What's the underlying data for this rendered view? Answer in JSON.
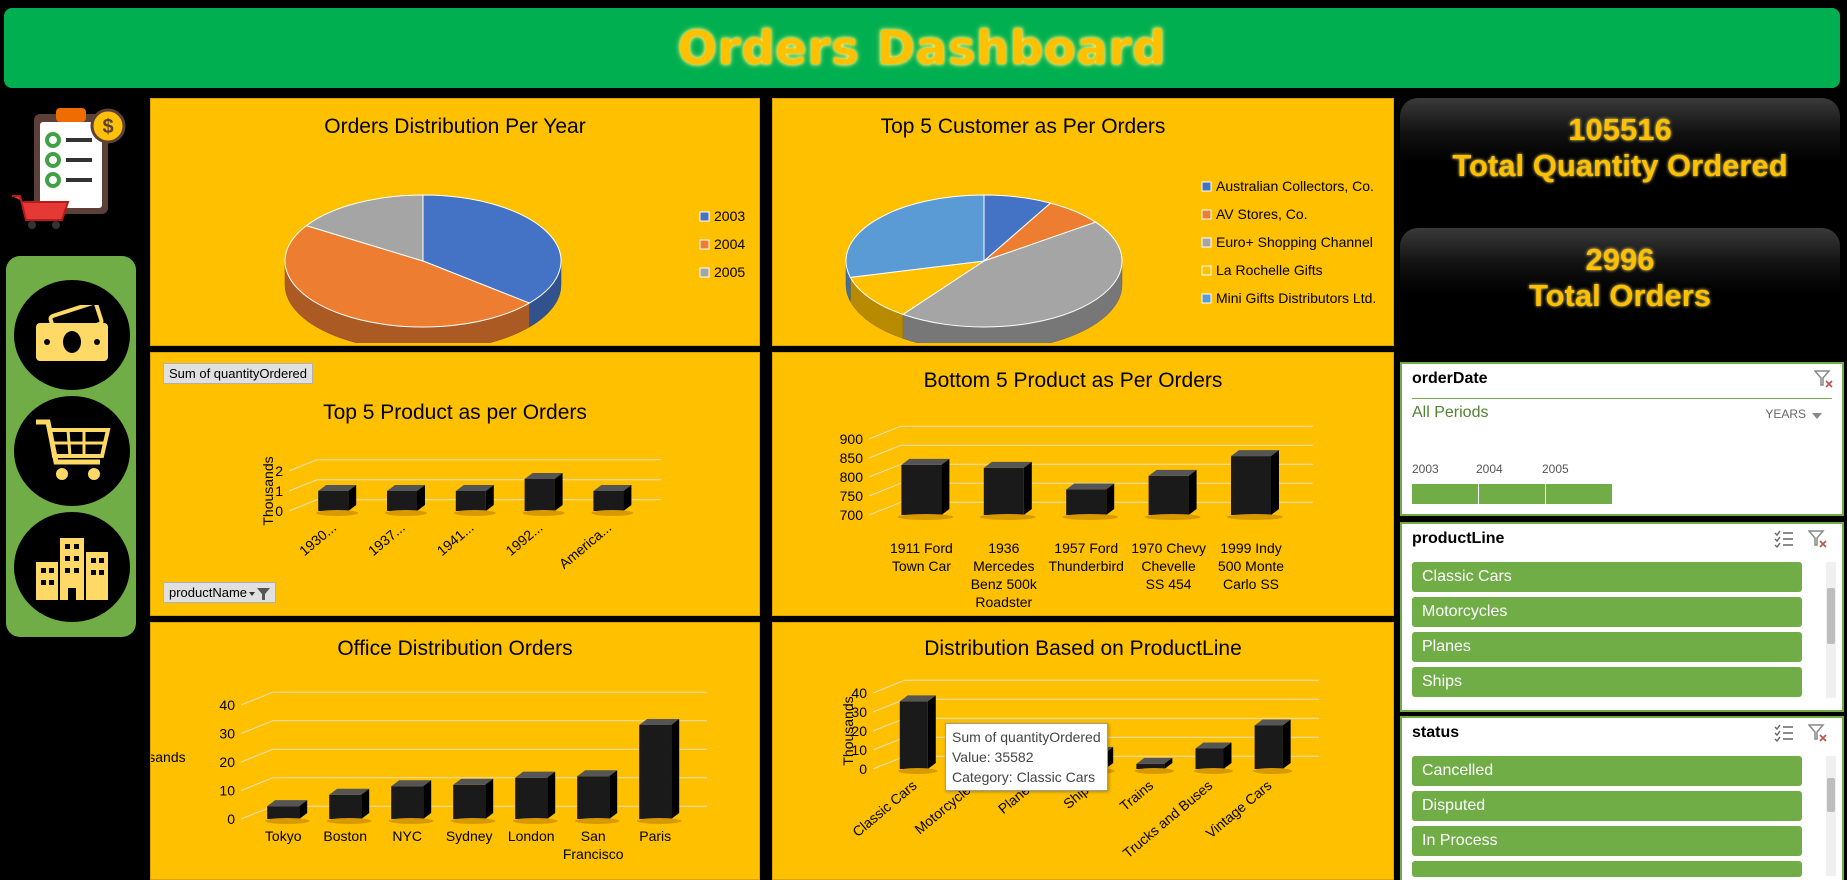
{
  "header": {
    "title": "Orders Dashboard"
  },
  "colors": {
    "header_bg": "#00b050",
    "panel_bg": "#ffc000",
    "slicer_green": "#70ad47",
    "pie_blue": "#4472c4",
    "pie_orange": "#ed7d31",
    "pie_gray": "#a5a5a5",
    "pie_yellow": "#ffc000",
    "pie_lightblue": "#5b9bd5"
  },
  "sidebar": {
    "logo_icon": "orders-clipboard-icon",
    "buttons": [
      {
        "icon": "cash-icon"
      },
      {
        "icon": "cart-icon"
      },
      {
        "icon": "buildings-icon"
      }
    ]
  },
  "kpis": [
    {
      "value": "105516",
      "label": "Total Quantity Ordered"
    },
    {
      "value": "2996",
      "label": "Total Orders"
    }
  ],
  "slicers": {
    "order_date": {
      "title": "orderDate",
      "all_periods": "All Periods",
      "level": "YEARS",
      "years": [
        "2003",
        "2004",
        "2005"
      ]
    },
    "product_line": {
      "title": "productLine",
      "items": [
        "Classic Cars",
        "Motorcycles",
        "Planes",
        "Ships"
      ]
    },
    "status": {
      "title": "status",
      "items": [
        "Cancelled",
        "Disputed",
        "In Process"
      ]
    }
  },
  "pivot_buttons": {
    "value_field": "Sum of quantityOrdered",
    "row_field": "productName"
  },
  "tooltip": {
    "line1": "Sum of quantityOrdered",
    "line2": "Value: 35582",
    "line3": "Category: Classic Cars"
  },
  "chart_data": [
    {
      "id": "orders-year",
      "type": "pie",
      "title": "Orders Distribution Per Year",
      "categories": [
        "2003",
        "2004",
        "2005"
      ],
      "values": [
        36,
        48,
        16
      ],
      "legend": "right"
    },
    {
      "id": "top-customers",
      "type": "pie",
      "title": "Top 5 Customer as Per Orders",
      "categories": [
        "Australian Collectors, Co.",
        "AV Stores, Co.",
        "Euro+ Shopping Channel",
        "La Rochelle Gifts",
        "Mini Gifts Distributors Ltd."
      ],
      "values": [
        8,
        7,
        45,
        11,
        29
      ],
      "legend": "right"
    },
    {
      "id": "top-products",
      "type": "bar",
      "title": "Top 5 Product as per Orders",
      "categories": [
        "1930...",
        "1937...",
        "1941...",
        "1992...",
        "America..."
      ],
      "values": [
        1.0,
        1.0,
        1.0,
        1.6,
        1.0
      ],
      "ylabel": "Thousands",
      "yticks": [
        "0",
        "1",
        "2"
      ],
      "ylim": [
        0,
        2
      ]
    },
    {
      "id": "bottom-products",
      "type": "bar",
      "title": "Bottom 5 Product as Per Orders",
      "categories": [
        "1911 Ford Town Car",
        "1936 Mercedes Benz 500k Roadster",
        "1957 Ford Thunderbird",
        "1970 Chevy Chevelle SS 454",
        "1999 Indy 500 Monte Carlo SS"
      ],
      "values": [
        832,
        824,
        767,
        803,
        855
      ],
      "yticks": [
        "700",
        "750",
        "800",
        "850",
        "900"
      ],
      "ylim": [
        700,
        900
      ]
    },
    {
      "id": "office-orders",
      "type": "bar",
      "title": "Office Distribution Orders",
      "categories": [
        "Tokyo",
        "Boston",
        "NYC",
        "Sydney",
        "London",
        "San Francisco",
        "Paris"
      ],
      "values": [
        4.5,
        8.5,
        11.5,
        12,
        14.5,
        15,
        33
      ],
      "ylabel": "Thousands",
      "yticks": [
        "0",
        "10",
        "20",
        "30",
        "40"
      ],
      "ylim": [
        0,
        40
      ]
    },
    {
      "id": "product-line",
      "type": "bar",
      "title": "Distribution Based on ProductLine",
      "categories": [
        "Classic Cars",
        "Motorcycles",
        "Planes",
        "Ships",
        "Trains",
        "Trucks and Buses",
        "Vintage Cars"
      ],
      "values": [
        35.582,
        12,
        11,
        8.5,
        2.7,
        10.8,
        22.9
      ],
      "ylabel": "Thousands",
      "yticks": [
        "0",
        "10",
        "20",
        "30",
        "40"
      ],
      "ylim": [
        0,
        40
      ]
    }
  ]
}
